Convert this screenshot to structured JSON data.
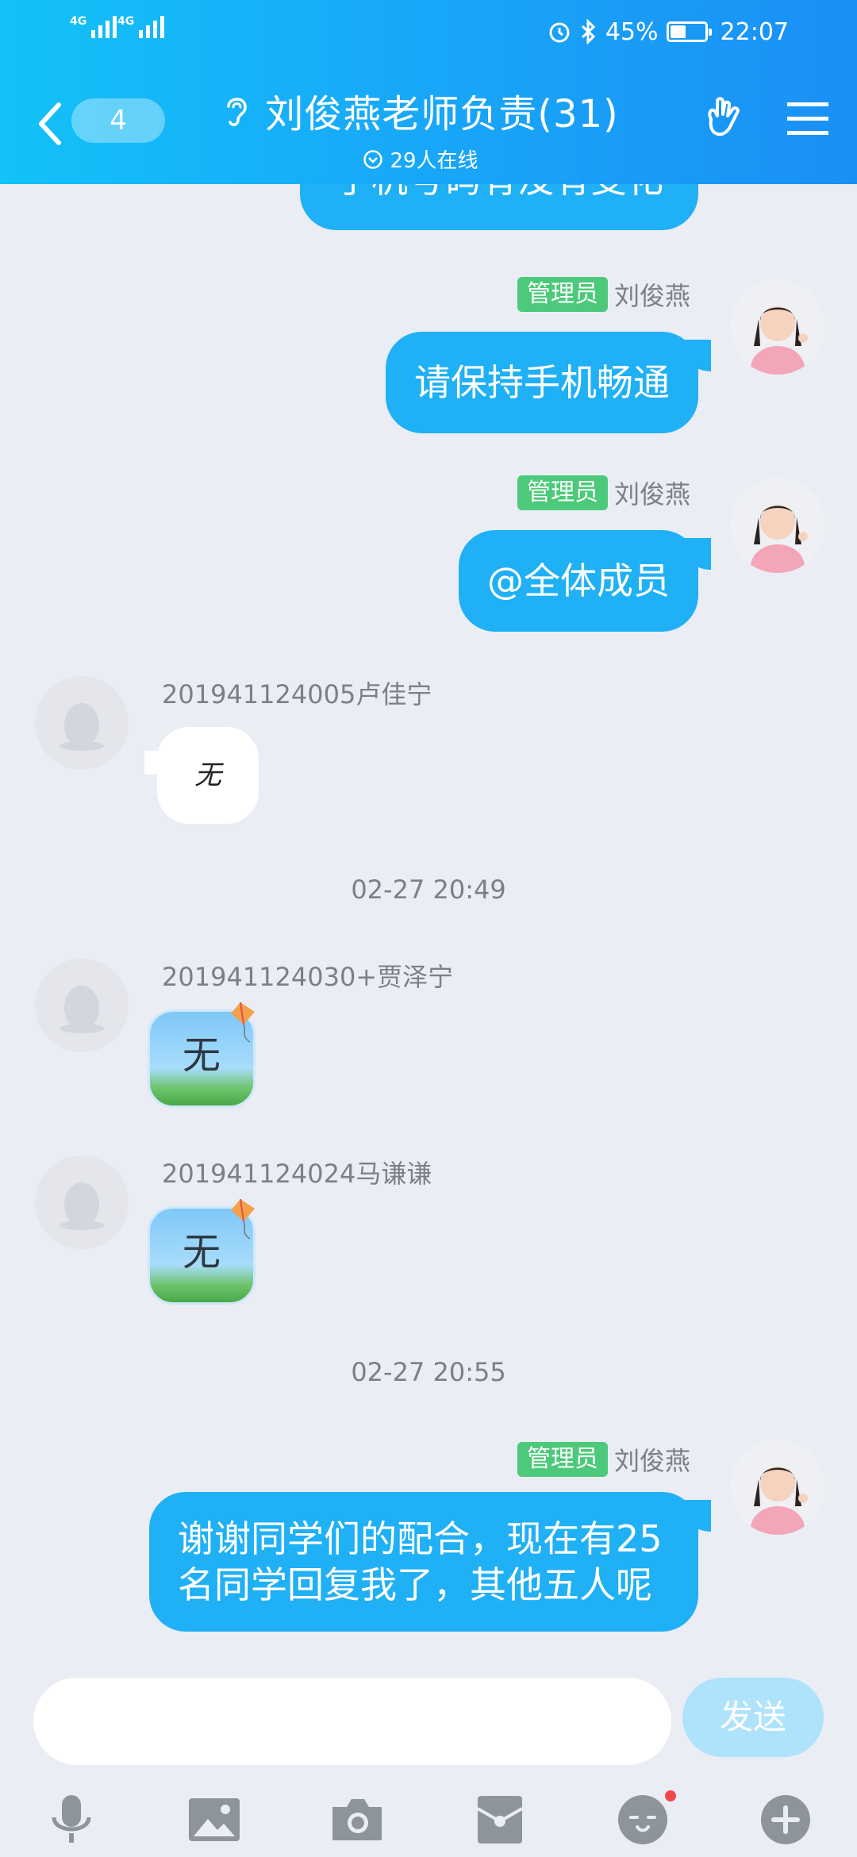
{
  "status_bar": {
    "network1": "4G",
    "network2": "4G",
    "battery_text": "45%",
    "battery_level": 0.45,
    "time": "22:07"
  },
  "header": {
    "back_count": "4",
    "title": "刘俊燕老师负责(31)",
    "online": "29人在线"
  },
  "messages": {
    "partial_top": "手机号码有没有变化",
    "m1": {
      "badge": "管理员",
      "sender": "刘俊燕",
      "text": "请保持手机畅通"
    },
    "m2": {
      "badge": "管理员",
      "sender": "刘俊燕",
      "text": "@全体成员"
    },
    "m3": {
      "sender": "201941124005卢佳宁",
      "text": "无"
    },
    "time1": "02-27 20:49",
    "m4": {
      "sender": "201941124030+贾泽宁",
      "text": "无"
    },
    "m5": {
      "sender": "201941124024马谦谦",
      "text": "无"
    },
    "time2": "02-27 20:55",
    "m6": {
      "badge": "管理员",
      "sender": "刘俊燕",
      "text": "谢谢同学们的配合，现在有25名同学回复我了，其他五人呢"
    }
  },
  "input": {
    "placeholder": "",
    "send_label": "发送"
  },
  "toolbar": {
    "icons": [
      "microphone-icon",
      "image-icon",
      "camera-icon",
      "red-packet-icon",
      "emoji-icon",
      "plus-icon"
    ]
  },
  "colors": {
    "header_start": "#12c2f8",
    "header_end": "#1a90f5",
    "bubble_blue": "#20b0f5",
    "badge_green": "#4cc97a",
    "chat_bg": "#ebedf5"
  }
}
